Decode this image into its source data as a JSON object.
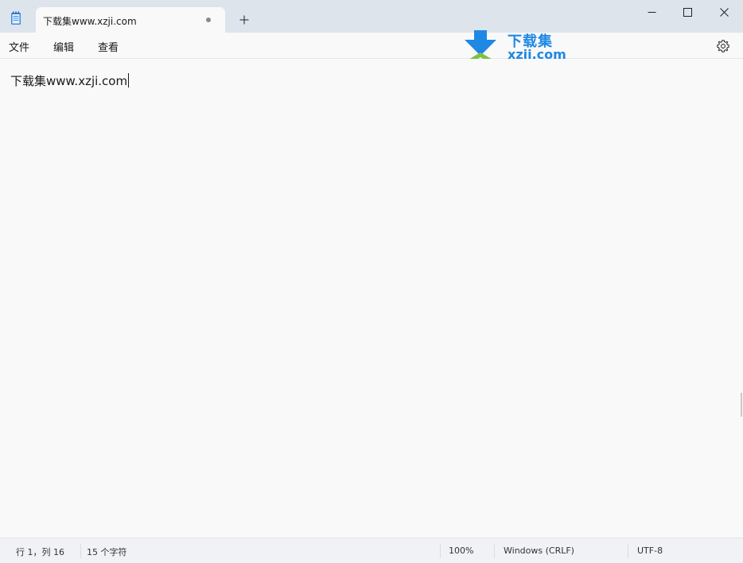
{
  "tab": {
    "title": "下载集www.xzji.com",
    "unsaved_dot_icon": "unsaved-dot-icon",
    "new_tab_icon": "plus-icon"
  },
  "window_controls": {
    "minimize_icon": "minimize-icon",
    "maximize_icon": "maximize-icon",
    "close_icon": "close-icon"
  },
  "menu": {
    "file": "文件",
    "edit": "编辑",
    "view": "查看",
    "settings_icon": "gear-icon"
  },
  "watermark": {
    "name": "下载集",
    "domain": "xzji.com",
    "colors": {
      "blue": "#1e88e5",
      "green": "#7cc242"
    }
  },
  "editor": {
    "content": "下载集www.xzji.com"
  },
  "status": {
    "position": "行 1，列 16",
    "char_count": "15 个字符",
    "zoom": "100%",
    "line_ending": "Windows (CRLF)",
    "encoding": "UTF-8"
  }
}
